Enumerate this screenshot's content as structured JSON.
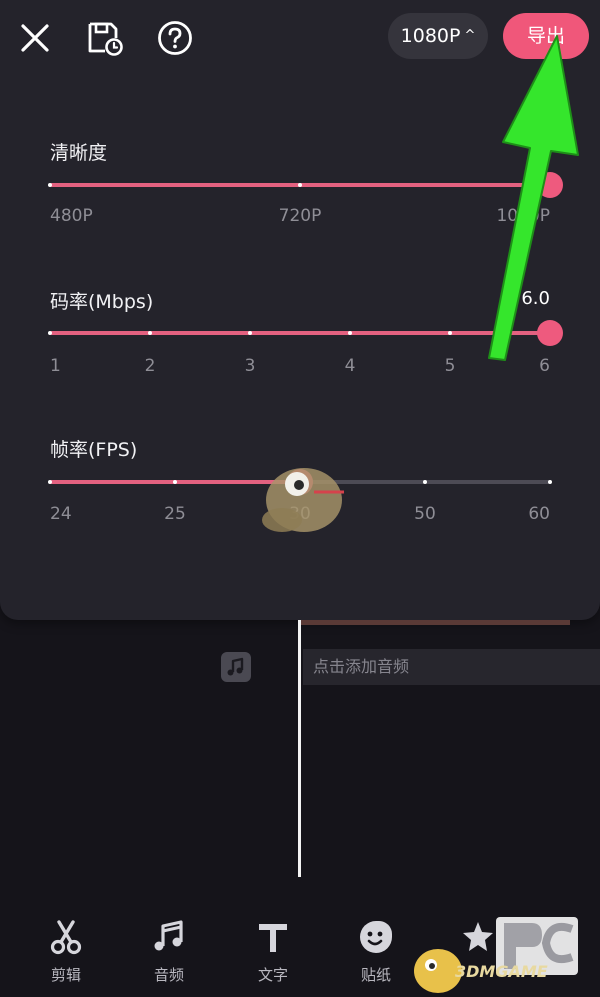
{
  "header": {
    "resolution_button": "1080P",
    "export_button": "导出"
  },
  "sections": {
    "resolution": {
      "label": "清晰度",
      "ticks": [
        "480P",
        "720P",
        "1080P"
      ],
      "selected_fraction": 1.0
    },
    "bitrate": {
      "label": "码率(Mbps)",
      "value": "6.0",
      "ticks": [
        "1",
        "2",
        "3",
        "4",
        "5",
        "6"
      ],
      "selected_fraction": 1.0
    },
    "framerate": {
      "label": "帧率(FPS)",
      "ticks": [
        "24",
        "25",
        "30",
        "50",
        "60"
      ],
      "selected_fraction": 0.5
    }
  },
  "timeline": {
    "add_audio": "点击添加音频"
  },
  "toolbar": {
    "items": [
      {
        "label": "剪辑",
        "icon": "scissors-icon"
      },
      {
        "label": "音频",
        "icon": "music-note-icon"
      },
      {
        "label": "文字",
        "icon": "text-icon"
      },
      {
        "label": "贴纸",
        "icon": "sticker-icon"
      },
      {
        "label": "",
        "icon": "effects-star-icon"
      }
    ]
  },
  "watermark": {
    "text": "3DMGAME"
  },
  "colors": {
    "accent": "#f0577a",
    "panel": "#24232b",
    "background": "#15141a",
    "arrow": "#35e62c"
  }
}
